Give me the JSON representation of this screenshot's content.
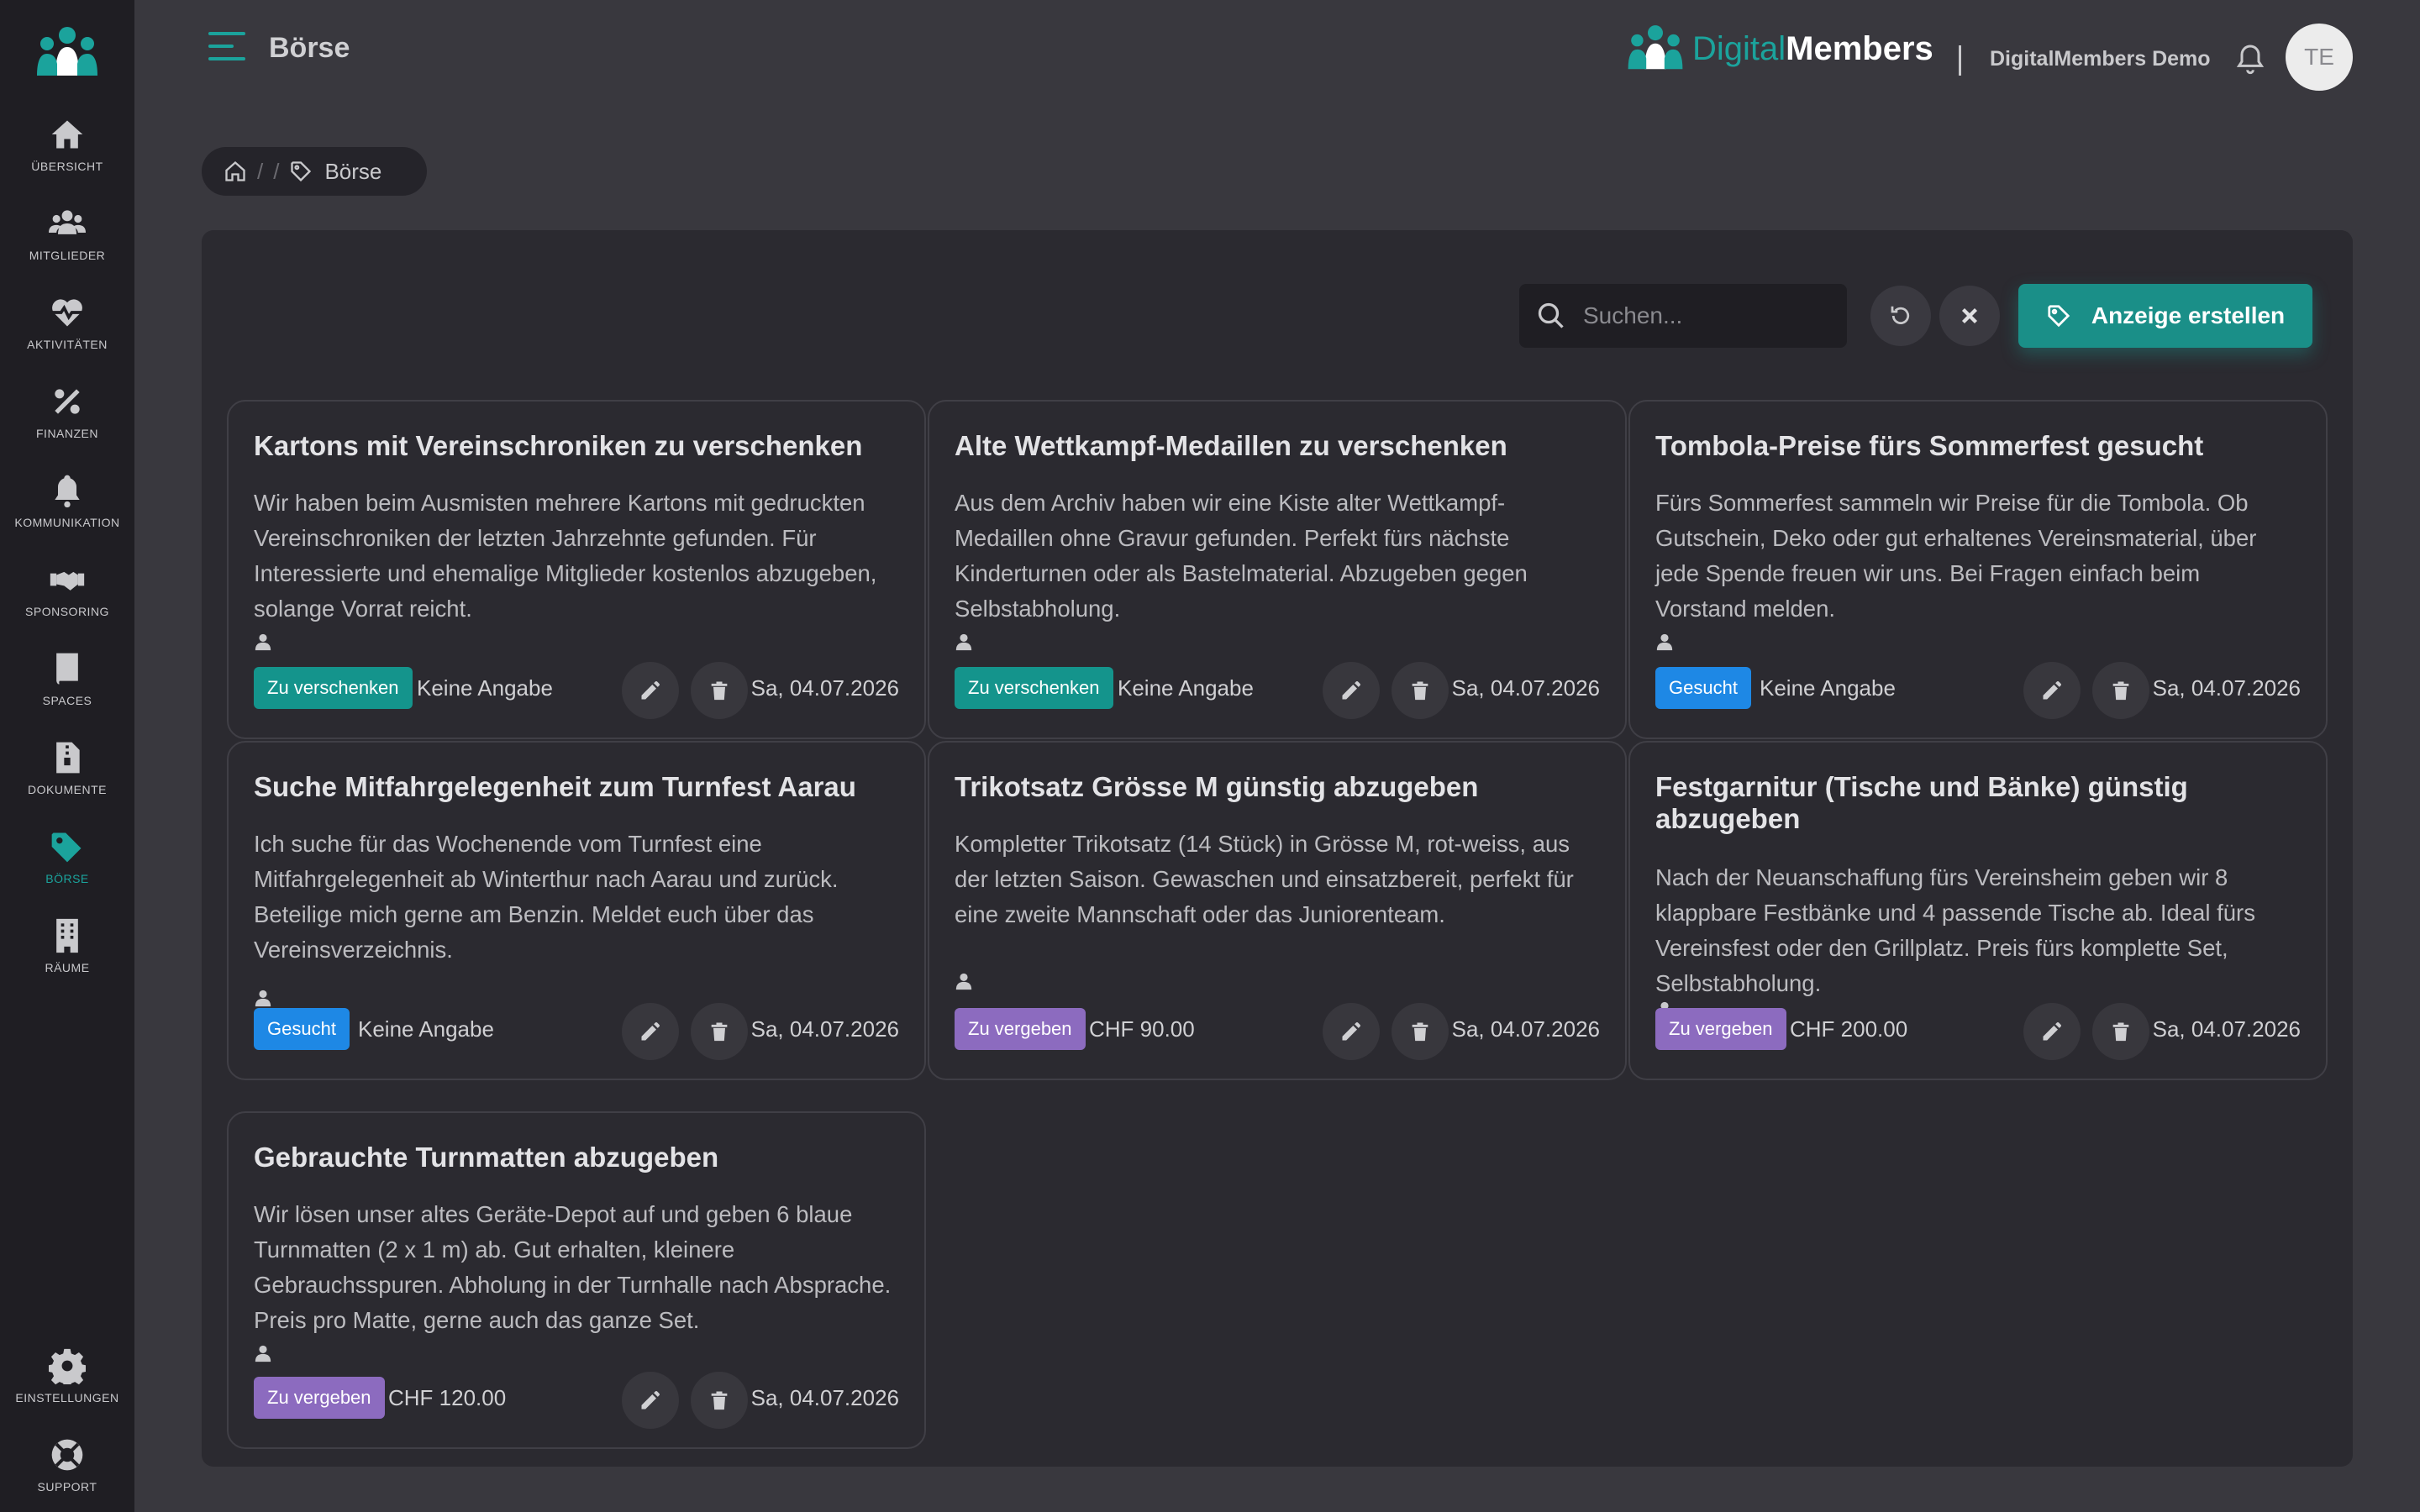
{
  "colors": {
    "accent": "#1ba39c",
    "badge_verschenken": "#14948c",
    "badge_gesucht": "#1e88e5",
    "badge_vergeben": "#8c6bbf"
  },
  "sidebar": {
    "items": [
      {
        "label": "ÜBERSICHT",
        "icon": "home-icon"
      },
      {
        "label": "MITGLIEDER",
        "icon": "users-icon"
      },
      {
        "label": "AKTIVITÄTEN",
        "icon": "heartbeat-icon"
      },
      {
        "label": "FINANZEN",
        "icon": "percent-icon"
      },
      {
        "label": "KOMMUNIKATION",
        "icon": "bell-icon"
      },
      {
        "label": "SPONSORING",
        "icon": "handshake-icon"
      },
      {
        "label": "SPACES",
        "icon": "book-icon"
      },
      {
        "label": "DOKUMENTE",
        "icon": "file-zip-icon"
      },
      {
        "label": "BÖRSE",
        "icon": "tag-icon"
      },
      {
        "label": "RÄUME",
        "icon": "building-icon"
      }
    ],
    "bottom": [
      {
        "label": "EINSTELLUNGEN",
        "icon": "gear-icon"
      },
      {
        "label": "SUPPORT",
        "icon": "lifebuoy-icon"
      }
    ]
  },
  "header": {
    "title": "Börse",
    "brand_part1": "Digital",
    "brand_part2": "Members",
    "org_name": "DigitalMembers Demo",
    "avatar_initials": "TE"
  },
  "breadcrumb": {
    "sep": "/",
    "current": "Börse"
  },
  "toolbar": {
    "search_placeholder": "Suchen...",
    "create_label": "Anzeige erstellen"
  },
  "cards": [
    {
      "title": "Kartons mit Vereinschroniken zu verschenken",
      "description": "Wir haben beim Ausmisten mehrere Kartons mit gedruckten Vereinschroniken der letzten Jahrzehnte gefunden. Für Interessierte und ehemalige Mitglieder kostenlos abzugeben, solange Vorrat reicht.",
      "badge": "Zu verschenken",
      "price": "Keine Angabe",
      "date": "Sa, 04.07.2026"
    },
    {
      "title": "Alte Wettkampf-Medaillen zu verschenken",
      "description": "Aus dem Archiv haben wir eine Kiste alter Wettkampf-Medaillen ohne Gravur gefunden. Perfekt fürs nächste Kinderturnen oder als Bastelmaterial. Abzugeben gegen Selbstabholung.",
      "badge": "Zu verschenken",
      "price": "Keine Angabe",
      "date": "Sa, 04.07.2026"
    },
    {
      "title": "Tombola-Preise fürs Sommerfest gesucht",
      "description": "Fürs Sommerfest sammeln wir Preise für die Tombola. Ob Gutschein, Deko oder gut erhaltenes Vereinsmaterial, über jede Spende freuen wir uns. Bei Fragen einfach beim Vorstand melden.",
      "badge": "Gesucht",
      "price": "Keine Angabe",
      "date": "Sa, 04.07.2026"
    },
    {
      "title": "Suche Mitfahrgelegenheit zum Turnfest Aarau",
      "description": "Ich suche für das Wochenende vom Turnfest eine Mitfahrgelegenheit ab Winterthur nach Aarau und zurück. Beteilige mich gerne am Benzin. Meldet euch über das Vereinsverzeichnis.",
      "badge": "Gesucht",
      "price": "Keine Angabe",
      "date": "Sa, 04.07.2026"
    },
    {
      "title": "Trikotsatz Grösse M günstig abzugeben",
      "description": "Kompletter Trikotsatz (14 Stück) in Grösse M, rot-weiss, aus der letzten Saison. Gewaschen und einsatzbereit, perfekt für eine zweite Mannschaft oder das Juniorenteam.",
      "badge": "Zu vergeben",
      "price": "CHF 90.00",
      "date": "Sa, 04.07.2026"
    },
    {
      "title": "Festgarnitur (Tische und Bänke) günstig abzugeben",
      "description": "Nach der Neuanschaffung fürs Vereinsheim geben wir 8 klappbare Festbänke und 4 passende Tische ab. Ideal fürs Vereinsfest oder den Grillplatz. Preis fürs komplette Set, Selbstabholung.",
      "badge": "Zu vergeben",
      "price": "CHF 200.00",
      "date": "Sa, 04.07.2026"
    },
    {
      "title": "Gebrauchte Turnmatten abzugeben",
      "description": "Wir lösen unser altes Geräte-Depot auf und geben 6 blaue Turnmatten (2 x 1 m) ab. Gut erhalten, kleinere Gebrauchsspuren. Abholung in der Turnhalle nach Absprache. Preis pro Matte, gerne auch das ganze Set.",
      "badge": "Zu vergeben",
      "price": "CHF 120.00",
      "date": "Sa, 04.07.2026"
    }
  ]
}
